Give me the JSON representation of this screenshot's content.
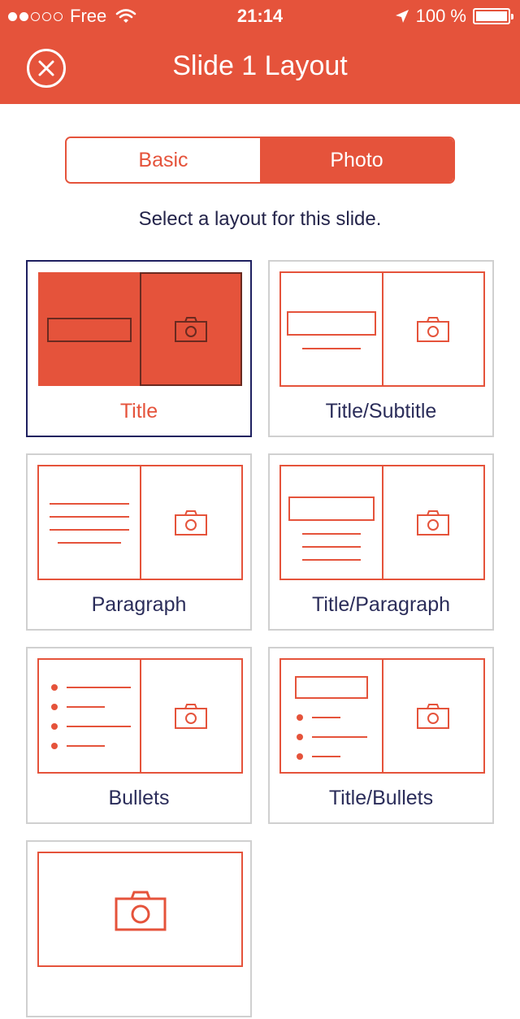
{
  "status_bar": {
    "carrier": "Free",
    "time": "21:14",
    "battery": "100 %"
  },
  "header": {
    "title": "Slide 1 Layout"
  },
  "segmented": {
    "basic": "Basic",
    "photo": "Photo",
    "selected": "Photo"
  },
  "instruction": "Select a layout for this slide.",
  "layouts": [
    {
      "label": "Title",
      "selected": true
    },
    {
      "label": "Title/Subtitle"
    },
    {
      "label": "Paragraph"
    },
    {
      "label": "Title/Paragraph"
    },
    {
      "label": "Bullets"
    },
    {
      "label": "Title/Bullets"
    },
    {
      "label": ""
    }
  ],
  "colors": {
    "accent": "#e5533b",
    "navy": "#2b2d5a",
    "border": "#d0d0d0"
  }
}
